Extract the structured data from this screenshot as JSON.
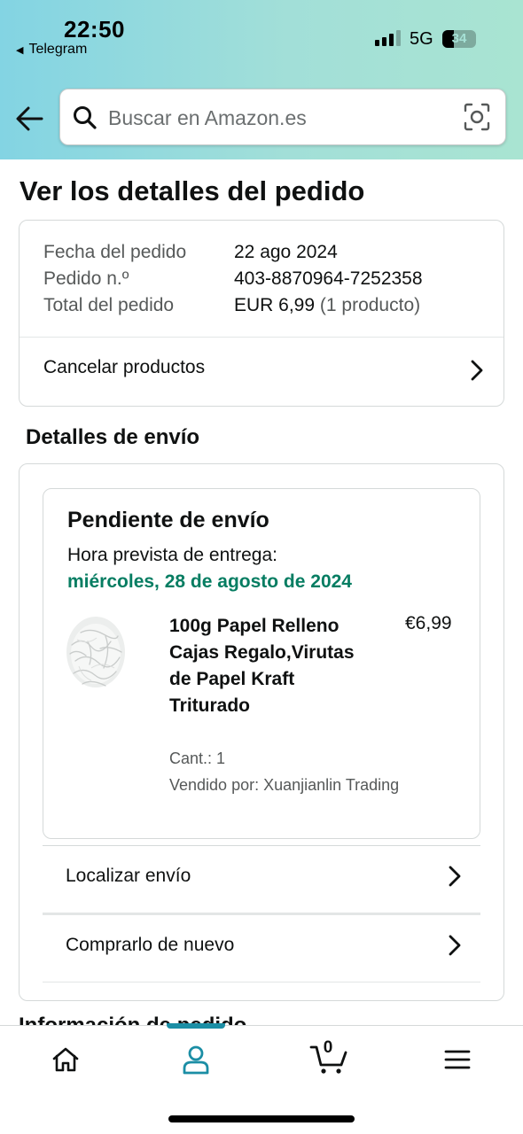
{
  "status_bar": {
    "time": "22:50",
    "back_app": "Telegram",
    "network": "5G",
    "battery": "34"
  },
  "search": {
    "placeholder": "Buscar en Amazon.es"
  },
  "page_title": "Ver los detalles del pedido",
  "order_summary": {
    "rows": [
      {
        "label": "Fecha del pedido",
        "value": "22 ago 2024",
        "extra": ""
      },
      {
        "label": "Pedido n.º",
        "value": "403-8870964-7252358",
        "extra": ""
      },
      {
        "label": "Total del pedido",
        "value": "EUR 6,99",
        "extra": "(1 producto)"
      }
    ],
    "cancel_label": "Cancelar productos"
  },
  "shipping": {
    "section_title": "Detalles de envío",
    "status": "Pendiente de envío",
    "eta_label": "Hora prevista de entrega:",
    "eta_date": "miércoles, 28 de agosto de 2024",
    "product": {
      "title": "100g Papel Relleno Cajas Regalo,Virutas de Papel Kraft Triturado",
      "price": "€6,99",
      "quantity": "Cant.: 1",
      "seller": "Vendido por: Xuanjianlin Trading"
    },
    "track_label": "Localizar envío",
    "buy_again_label": "Comprarlo de nuevo"
  },
  "peek_heading": "Información de pedido",
  "bottom_nav": {
    "items": [
      {
        "name": "home",
        "icon": "home-icon"
      },
      {
        "name": "account",
        "icon": "user-icon",
        "active": true
      },
      {
        "name": "cart",
        "icon": "cart-icon",
        "count": "0"
      },
      {
        "name": "menu",
        "icon": "menu-icon"
      }
    ]
  },
  "colors": {
    "accent": "#1b8ea5",
    "delivery_green": "#067d62",
    "header_gradient_start": "#83d4e3",
    "header_gradient_end": "#a9e4d2"
  }
}
